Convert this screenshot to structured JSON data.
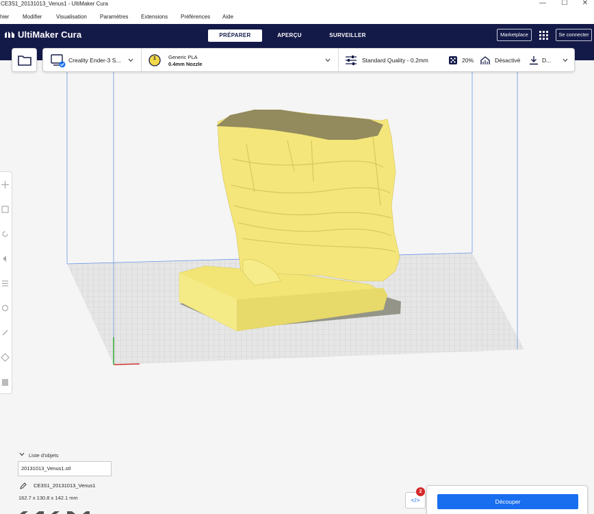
{
  "window": {
    "title": "CE3S1_20131013_Venus1 - UltiMaker Cura",
    "minimize": "—",
    "maximize": "☐",
    "close": "✕"
  },
  "menu": [
    "hier",
    "Modifier",
    "Visualisation",
    "Paramètres",
    "Extensions",
    "Préférences",
    "Aide"
  ],
  "header": {
    "brand": "UltiMaker Cura",
    "stages": [
      "PRÉPARER",
      "APERÇU",
      "SURVEILLER"
    ],
    "active_stage": 0,
    "marketplace": "Marketplace",
    "signin": "Se connecter"
  },
  "settings": {
    "printer": "Creality Ender-3 S...",
    "extruder_number": "1",
    "material": "Generic PLA",
    "nozzle": "0.4mm Nozzle",
    "quality": "Standard Quality - 0.2mm",
    "infill": "20%",
    "support": "Désactivé",
    "adhesion": "D..."
  },
  "objects": {
    "title": "Liste d'objets",
    "items": [
      "20131013_Venus1.stl"
    ],
    "job_name": "CE3S1_20131013_Venus1",
    "dimensions": "162.7 x 130.8 x 142.1 mm"
  },
  "actions": {
    "code_icon": "</>",
    "badge_count": "2",
    "slice": "Découper"
  },
  "colors": {
    "header": "#141a48",
    "accent": "#196ef0",
    "model": "#f2e576",
    "build_volume_lines": "#5d8fe0",
    "badge": "#d72828"
  },
  "icons": [
    "folder-icon",
    "printer-icon",
    "check-badge-icon",
    "extruder-icon",
    "chevron-down-icon",
    "sliders-icon",
    "infill-icon",
    "support-icon",
    "adhesion-icon",
    "grid-apps-icon",
    "move-icon",
    "scale-icon",
    "rotate-icon",
    "mirror-icon",
    "per-model-settings-icon",
    "support-blocker-icon",
    "pencil-icon",
    "view-cube-icon"
  ]
}
